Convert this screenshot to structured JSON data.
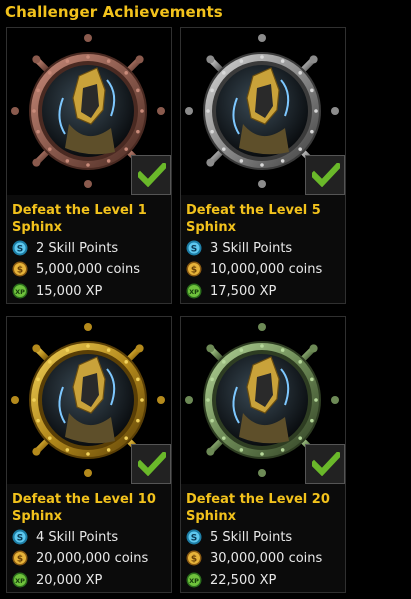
{
  "page_title": "Challenger Achievements",
  "cards": [
    {
      "title": "Defeat the Level 1 Sphinx",
      "medal": "bronze",
      "colors": {
        "outer": "#c98b7a",
        "mid": "#8a5a4d",
        "dark": "#4a2a22"
      },
      "completed": true,
      "skill_points": "2 Skill Points",
      "coins": "5,000,000 coins",
      "xp": "15,000 XP"
    },
    {
      "title": "Defeat the Level 5 Sphinx",
      "medal": "silver",
      "colors": {
        "outer": "#d8d8d8",
        "mid": "#8c8c8c",
        "dark": "#3b3b3b"
      },
      "completed": true,
      "skill_points": "3 Skill Points",
      "coins": "10,000,000 coins",
      "xp": "17,500 XP"
    },
    {
      "title": "Defeat the Level 10 Sphinx",
      "medal": "gold",
      "colors": {
        "outer": "#f2d25a",
        "mid": "#b48a1c",
        "dark": "#5a3f06"
      },
      "completed": true,
      "skill_points": "4 Skill Points",
      "coins": "20,000,000 coins",
      "xp": "20,000 XP"
    },
    {
      "title": "Defeat the Level 20 Sphinx",
      "medal": "green",
      "colors": {
        "outer": "#b6d89a",
        "mid": "#6d8a56",
        "dark": "#2e3d22"
      },
      "completed": true,
      "skill_points": "5 Skill Points",
      "coins": "30,000,000 coins",
      "xp": "22,500 XP"
    }
  ],
  "icons": {
    "skill": "skill-point-icon",
    "coin": "coin-icon",
    "xp": "xp-icon",
    "check": "checkmark-icon"
  },
  "accent": "#f2c21c"
}
